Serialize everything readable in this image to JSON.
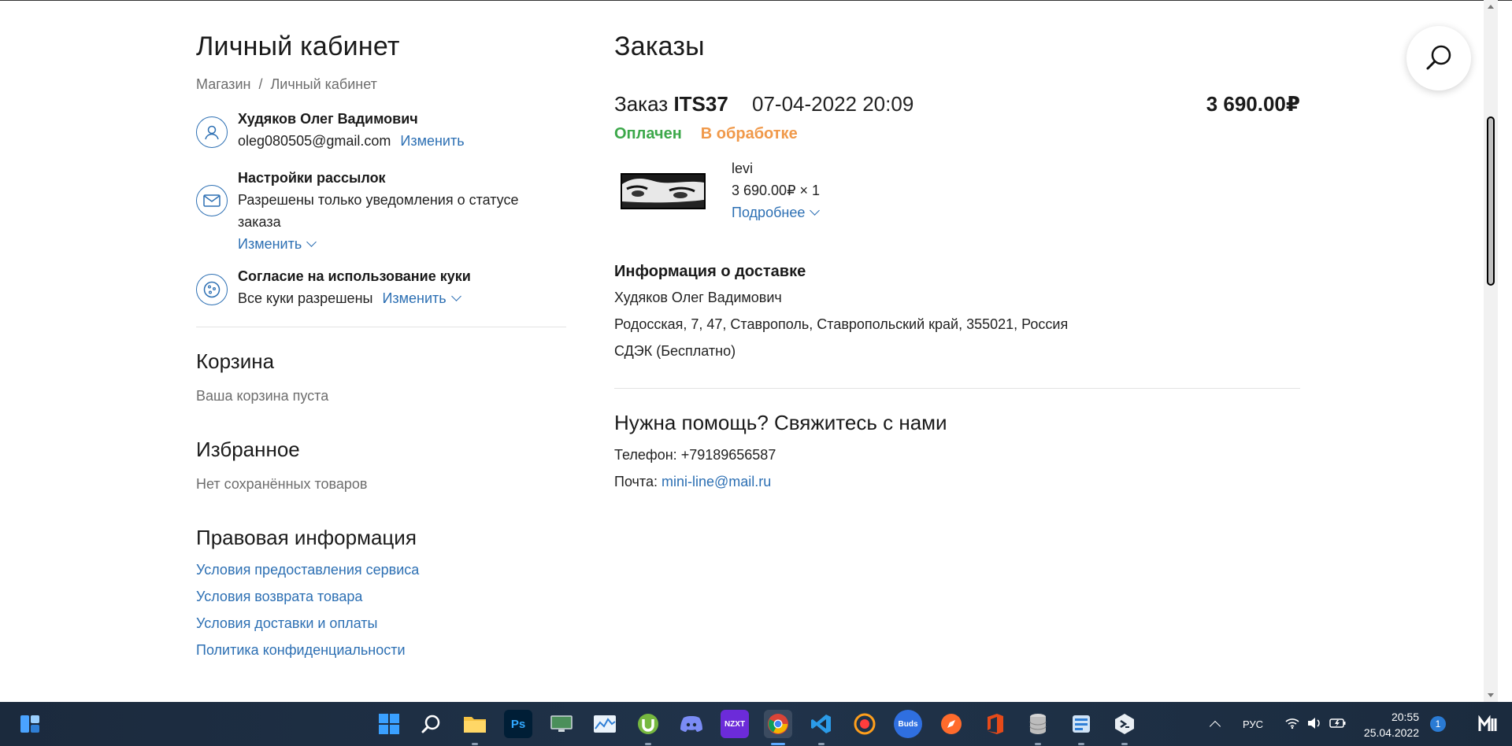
{
  "account": {
    "title": "Личный кабинет",
    "breadcrumb": [
      "Магазин",
      "/",
      "Личный кабинет"
    ],
    "user": {
      "name": "Худяков Олег Вадимович",
      "email": "oleg080505@gmail.com",
      "edit": "Изменить"
    },
    "mailing": {
      "title": "Настройки рассылок",
      "text": "Разрешены только уведомления о статусе заказа",
      "edit": "Изменить"
    },
    "cookies": {
      "title": "Согласие на использование куки",
      "text": "Все куки разрешены",
      "edit": "Изменить"
    }
  },
  "cart": {
    "title": "Корзина",
    "text": "Ваша корзина пуста"
  },
  "favorites": {
    "title": "Избранное",
    "text": "Нет сохранённых товаров"
  },
  "legal": {
    "title": "Правовая информация",
    "links": [
      "Условия предоставления сервиса",
      "Условия возврата товара",
      "Условия доставки и оплаты",
      "Политика конфиденциальности"
    ]
  },
  "orders": {
    "title": "Заказы",
    "order": {
      "prefix": "Заказ",
      "number": "ITS37",
      "date": "07-04-2022 20:09",
      "total": "3 690.00₽",
      "status_paid": "Оплачен",
      "status_processing": "В обработке",
      "item": {
        "name": "levi",
        "price_qty": "3 690.00₽ × 1",
        "details": "Подробнее"
      }
    }
  },
  "delivery": {
    "title": "Информация о доставке",
    "name": "Худяков Олег Вадимович",
    "address": "Родосская, 7, 47, Ставрополь, Ставропольский край, 355021, Россия",
    "method": "СДЭК (Бесплатно)"
  },
  "help": {
    "title": "Нужна помощь? Свяжитесь с нами",
    "phone_label": "Телефон:",
    "phone": "+79189656587",
    "mail_label": "Почта:",
    "mail": "mini-line@mail.ru"
  },
  "taskbar": {
    "apps": [
      "start-icon",
      "search-icon",
      "file-explorer-icon",
      "photoshop-icon",
      "display-icon",
      "task-manager-icon",
      "utorrent-icon",
      "discord-icon",
      "nzxt-icon",
      "chrome-icon",
      "vscode-icon",
      "music-icon",
      "buds-icon",
      "compass-icon",
      "office-icon",
      "database-icon",
      "app-icon",
      "terminal-icon"
    ],
    "ps_label": "Ps",
    "nzxt_label": "NZXT",
    "buds_label": "Buds",
    "lang": "РУС",
    "time": "20:55",
    "date": "25.04.2022",
    "notifications": "1"
  }
}
